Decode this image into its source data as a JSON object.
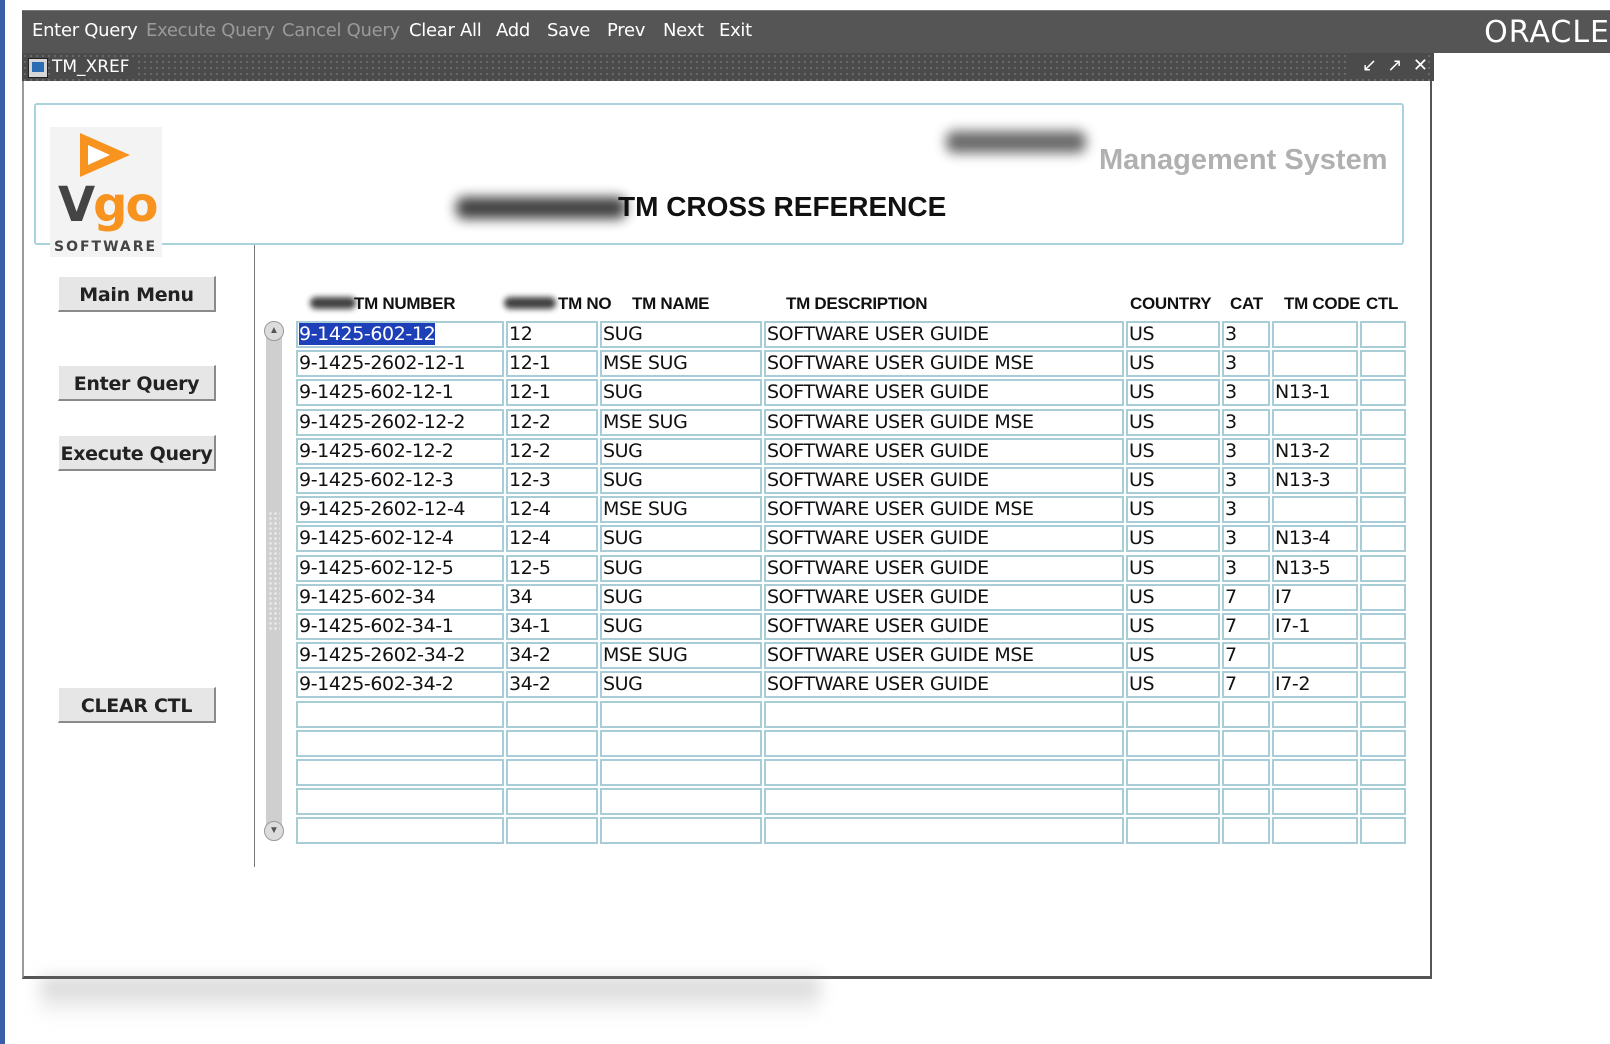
{
  "menubar": {
    "items": [
      {
        "label": "Enter Query",
        "enabled": true
      },
      {
        "label": "Execute Query",
        "enabled": false
      },
      {
        "label": "Cancel Query",
        "enabled": false
      },
      {
        "label": "Clear All",
        "enabled": true
      },
      {
        "label": "Add",
        "enabled": true
      },
      {
        "label": "Save",
        "enabled": true
      },
      {
        "label": "Prev",
        "enabled": true
      },
      {
        "label": "Next",
        "enabled": true
      },
      {
        "label": "Exit",
        "enabled": true
      }
    ],
    "brand": "ORACLE"
  },
  "window": {
    "title": "TM_XREF",
    "controls": [
      "minimize-icon",
      "maximize-icon",
      "close-icon"
    ]
  },
  "header": {
    "logo_main": "VGO",
    "logo_sub": "SOFTWARE",
    "system_title": "Management System",
    "page_title": "TM CROSS REFERENCE"
  },
  "side_buttons": {
    "main_menu": "Main Menu",
    "enter_query": "Enter Query",
    "execute_query": "Execute Query",
    "clear_ctl": "CLEAR CTL"
  },
  "grid": {
    "columns": [
      "TM NUMBER",
      "TM NO",
      "TM NAME",
      "TM DESCRIPTION",
      "COUNTRY",
      "CAT",
      "TM CODE",
      "CTL"
    ],
    "rows": [
      [
        "9-1425-602-12",
        "12",
        "SUG",
        "SOFTWARE USER GUIDE",
        "US",
        "3",
        "",
        ""
      ],
      [
        "9-1425-2602-12-1",
        "12-1",
        "MSE SUG",
        "SOFTWARE USER GUIDE MSE",
        "US",
        "3",
        "",
        ""
      ],
      [
        "9-1425-602-12-1",
        "12-1",
        "SUG",
        "SOFTWARE USER GUIDE",
        "US",
        "3",
        "N13-1",
        ""
      ],
      [
        "9-1425-2602-12-2",
        "12-2",
        "MSE SUG",
        "SOFTWARE USER GUIDE MSE",
        "US",
        "3",
        "",
        ""
      ],
      [
        "9-1425-602-12-2",
        "12-2",
        "SUG",
        "SOFTWARE USER GUIDE",
        "US",
        "3",
        "N13-2",
        ""
      ],
      [
        "9-1425-602-12-3",
        "12-3",
        "SUG",
        "SOFTWARE USER GUIDE",
        "US",
        "3",
        "N13-3",
        ""
      ],
      [
        "9-1425-2602-12-4",
        "12-4",
        "MSE SUG",
        "SOFTWARE USER GUIDE MSE",
        "US",
        "3",
        "",
        ""
      ],
      [
        "9-1425-602-12-4",
        "12-4",
        "SUG",
        "SOFTWARE USER GUIDE",
        "US",
        "3",
        "N13-4",
        ""
      ],
      [
        "9-1425-602-12-5",
        "12-5",
        "SUG",
        "SOFTWARE USER GUIDE",
        "US",
        "3",
        "N13-5",
        ""
      ],
      [
        "9-1425-602-34",
        "34",
        "SUG",
        "SOFTWARE USER GUIDE",
        "US",
        "7",
        "I7",
        ""
      ],
      [
        "9-1425-602-34-1",
        "34-1",
        "SUG",
        "SOFTWARE USER GUIDE",
        "US",
        "7",
        "I7-1",
        ""
      ],
      [
        "9-1425-2602-34-2",
        "34-2",
        "MSE SUG",
        "SOFTWARE USER GUIDE MSE",
        "US",
        "7",
        "",
        ""
      ],
      [
        "9-1425-602-34-2",
        "34-2",
        "SUG",
        "SOFTWARE USER GUIDE",
        "US",
        "7",
        "I7-2",
        ""
      ],
      [
        "",
        "",
        "",
        "",
        "",
        "",
        "",
        ""
      ],
      [
        "",
        "",
        "",
        "",
        "",
        "",
        "",
        ""
      ],
      [
        "",
        "",
        "",
        "",
        "",
        "",
        "",
        ""
      ],
      [
        "",
        "",
        "",
        "",
        "",
        "",
        "",
        ""
      ],
      [
        "",
        "",
        "",
        "",
        "",
        "",
        "",
        ""
      ]
    ],
    "selected_row": 0
  },
  "colors": {
    "menubar_bg": "#555555",
    "cell_border": "#a9cdd6",
    "selection": "#1d3fb8",
    "logo_accent": "#f7931e"
  }
}
